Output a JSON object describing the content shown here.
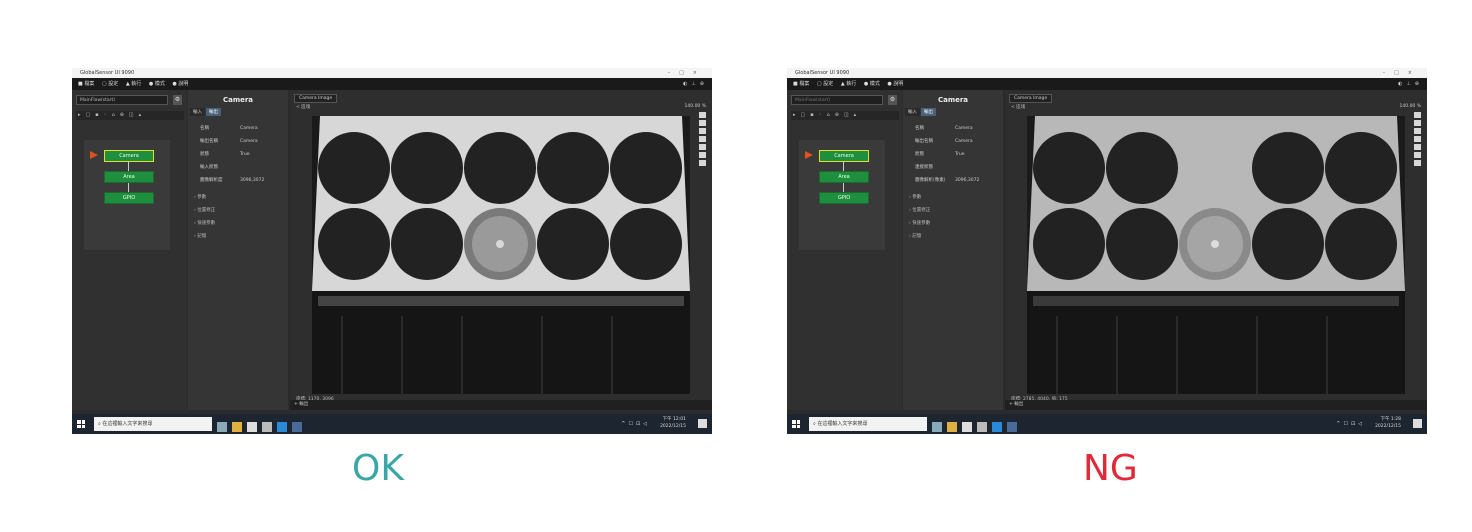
{
  "colors": {
    "ok": "#3aa6a6",
    "ng": "#e02a3a",
    "node": "#1e8f3e",
    "selected_border": "#e6dc2a",
    "input_arrow": "#e05020"
  },
  "ok": {
    "label": "OK",
    "app": {
      "title": "GlobalSensor UI 9090",
      "combo_value": "MainFlow(start)",
      "panel_title": "Camera",
      "tabs": [
        "輸入",
        "輸出"
      ],
      "properties": [
        {
          "key": "名稱",
          "value": "Camera"
        },
        {
          "key": "輸出名稱",
          "value": "Camera"
        },
        {
          "key": "狀態",
          "value": "True"
        },
        {
          "key": "輸入狀態",
          "value": ""
        },
        {
          "key": "圖像解析度",
          "value": "3096,3072"
        }
      ],
      "sections": [
        "參數",
        "位置修正",
        "快速參數",
        "記憶"
      ],
      "nodes": [
        "Camera",
        "Area",
        "GPIO"
      ],
      "view_tab": "Camera Image",
      "view_crumb": "< 區塊",
      "zoom": "140.00 %",
      "coords": "座標: 1170, 3096",
      "bottom_label": "+ 輸出"
    },
    "taskbar": {
      "search_placeholder": "在這裡輸入文字來搜尋",
      "time": "下午 12:01",
      "date": "2022/12/15"
    }
  },
  "ng": {
    "label": "NG",
    "app": {
      "title": "GlobalSensor UI 9090",
      "combo_value": "MainFlow(start)",
      "panel_title": "Camera",
      "tabs": [
        "輸入",
        "輸出"
      ],
      "properties": [
        {
          "key": "名稱",
          "value": "Camera"
        },
        {
          "key": "輸出名稱",
          "value": "Camera"
        },
        {
          "key": "狀態",
          "value": "True"
        },
        {
          "key": "連接狀態",
          "value": ""
        },
        {
          "key": "圖像解析(像素)",
          "value": "3096,3072"
        }
      ],
      "sections": [
        "參數",
        "位置修正",
        "快速參數",
        "記憶"
      ],
      "nodes": [
        "Camera",
        "Area",
        "GPIO"
      ],
      "view_tab": "Camera Image",
      "view_crumb": "< 區塊",
      "zoom": "140.00 %",
      "coords": "座標: 2785, 4040, 值: 175",
      "bottom_label": "+ 輸出"
    },
    "taskbar": {
      "search_placeholder": "在這裡輸入文字來搜尋",
      "time": "下午 1:28",
      "date": "2022/12/15"
    }
  }
}
